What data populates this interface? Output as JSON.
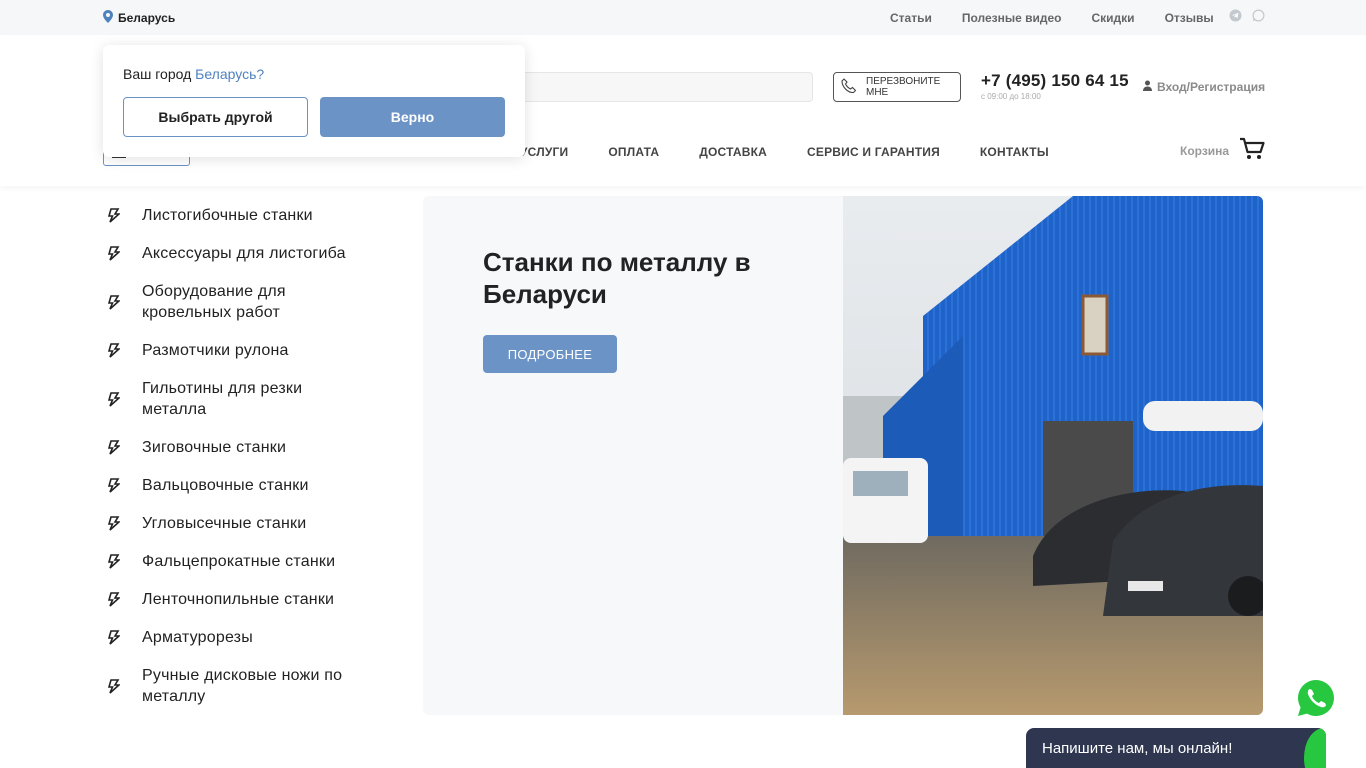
{
  "topbar": {
    "region": "Беларусь",
    "nav": [
      "Статьи",
      "Полезные видео",
      "Скидки",
      "Отзывы"
    ],
    "socials": [
      "telegram-icon",
      "whatsapp-icon"
    ]
  },
  "header": {
    "callback_label": "ПЕРЕЗВОНИТЕ МНЕ",
    "phone": "+7 (495) 150 64 15",
    "hours": "с 09:00 до 18:00",
    "login": "Вход/Регистрация",
    "cart": "Корзина",
    "nav": [
      "УСЛУГИ",
      "ОПЛАТА",
      "ДОСТАВКА",
      "СЕРВИС И ГАРАНТИЯ",
      "КОНТАКТЫ"
    ]
  },
  "city_popup": {
    "question": "Ваш город",
    "city": "Беларусь?",
    "other_button": "Выбрать другой",
    "ok_button": "Верно"
  },
  "categories": [
    "Листогибочные станки",
    "Аксессуары для листогиба",
    "Оборудование для кровельных работ",
    "Размотчики рулона",
    "Гильотины для резки металла",
    "Зиговочные станки",
    "Вальцовочные станки",
    "Угловысечные станки",
    "Фальцепрокатные станки",
    "Ленточнопильные станки",
    "Арматурорезы",
    "Ручные дисковые ножи по металлу"
  ],
  "banner": {
    "title": "Станки по металлу в Беларуси",
    "button": "ПОДРОБНЕЕ"
  },
  "chat": {
    "label": "Напишите нам, мы онлайн!"
  },
  "colors": {
    "accent": "#6b93c6",
    "link": "#4f82bd",
    "chat_bg": "#2e3650",
    "whatsapp": "#27c840"
  }
}
